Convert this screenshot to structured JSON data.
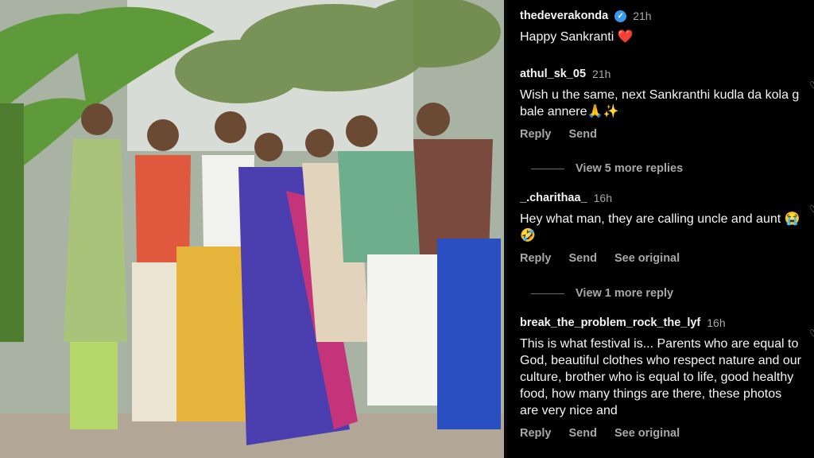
{
  "photo": {
    "alt_subject": "family-group-photo"
  },
  "comments": [
    {
      "username": "thedeverakonda",
      "verified": true,
      "time": "21h",
      "text": "Happy Sankranti ❤️",
      "actions": []
    },
    {
      "username": "athul_sk_05",
      "verified": false,
      "time": "21h",
      "text": "Wish u the same, next Sankranthi kudla da kola g bale annere🙏✨",
      "actions": [
        "Reply",
        "Send"
      ]
    },
    {
      "username": "_.charithaa_",
      "verified": false,
      "time": "16h",
      "text": "Hey what man, they are calling uncle and aunt 😭 🤣",
      "actions": [
        "Reply",
        "Send",
        "See original"
      ]
    },
    {
      "username": "break_the_problem_rock_the_lyf",
      "verified": false,
      "time": "16h",
      "text": "This is what festival is... Parents who are equal to God, beautiful clothes who respect nature and our culture, brother who is equal to life, good healthy food, how many things are there, these photos are very nice and",
      "actions": [
        "Reply",
        "Send",
        "See original"
      ]
    }
  ],
  "view_replies": [
    "View 5 more replies",
    "View 1 more reply"
  ],
  "colors": {
    "background": "#000000",
    "text": "#f5f5f5",
    "muted": "#a8a8a8",
    "verified": "#3897f0"
  }
}
